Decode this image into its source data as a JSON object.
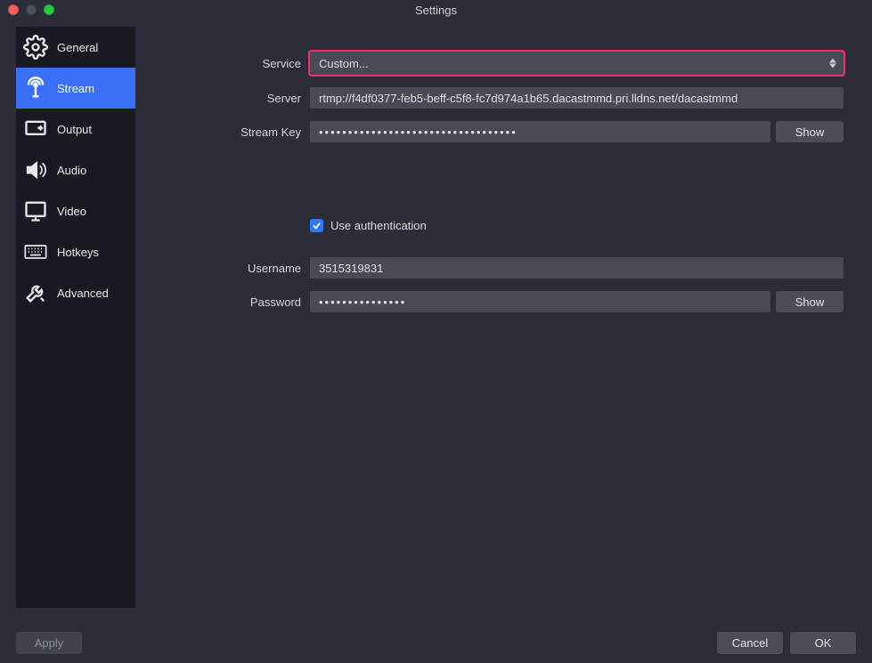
{
  "window": {
    "title": "Settings"
  },
  "sidebar": {
    "items": [
      {
        "label": "General"
      },
      {
        "label": "Stream"
      },
      {
        "label": "Output"
      },
      {
        "label": "Audio"
      },
      {
        "label": "Video"
      },
      {
        "label": "Hotkeys"
      },
      {
        "label": "Advanced"
      }
    ]
  },
  "form": {
    "service_label": "Service",
    "service_value": "Custom...",
    "server_label": "Server",
    "server_value": "rtmp://f4df0377-feb5-beff-c5f8-fc7d974a1b65.dacastmmd.pri.lldns.net/dacastmmd",
    "streamkey_label": "Stream Key",
    "streamkey_value": "••••••••••••••••••••••••••••••••••",
    "show_label": "Show",
    "useauth_label": "Use authentication",
    "username_label": "Username",
    "username_value": "3515319831",
    "password_label": "Password",
    "password_value": "•••••••••••••••"
  },
  "buttons": {
    "apply": "Apply",
    "cancel": "Cancel",
    "ok": "OK"
  }
}
